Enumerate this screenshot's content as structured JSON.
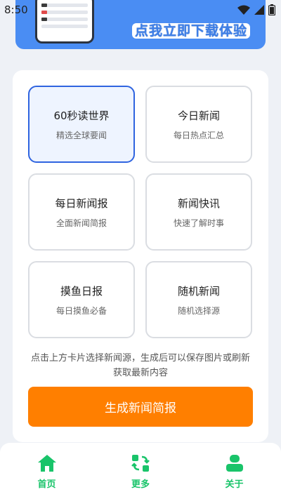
{
  "status_bar": {
    "time": "8:50"
  },
  "banner": {
    "text": "点我立即下载体验"
  },
  "sources": [
    {
      "title": "60秒读世界",
      "subtitle": "精选全球要闻"
    },
    {
      "title": "今日新闻",
      "subtitle": "每日热点汇总"
    },
    {
      "title": "每日新闻报",
      "subtitle": "全面新闻简报"
    },
    {
      "title": "新闻快讯",
      "subtitle": "快速了解时事"
    },
    {
      "title": "摸鱼日报",
      "subtitle": "每日摸鱼必备"
    },
    {
      "title": "随机新闻",
      "subtitle": "随机选择源"
    }
  ],
  "hint": "点击上方卡片选择新闻源，生成后可以保存图片或刷新获取最新内容",
  "generate_button": "生成新闻简报",
  "nav": [
    {
      "label": "首页",
      "icon": "home-icon"
    },
    {
      "label": "更多",
      "icon": "more-icon"
    },
    {
      "label": "关于",
      "icon": "user-icon"
    }
  ],
  "colors": {
    "accent_green": "#19c46a",
    "button_orange": "#ff7f00",
    "selected_blue": "#2f64e0",
    "banner_blue": "#4a8df3"
  }
}
